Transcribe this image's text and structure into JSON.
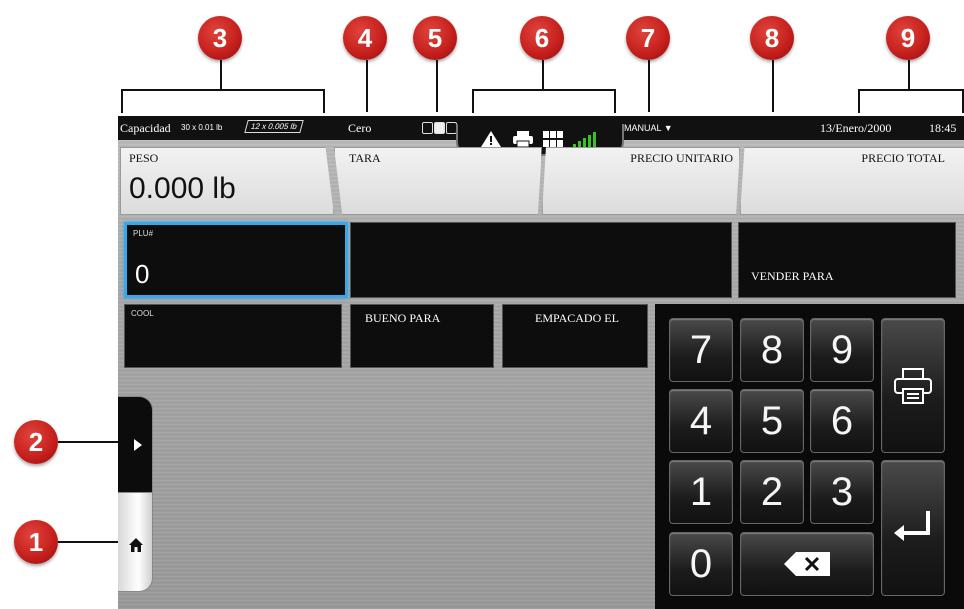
{
  "callouts": [
    "1",
    "2",
    "3",
    "4",
    "5",
    "6",
    "7",
    "8",
    "9"
  ],
  "statusbar": {
    "capacity_label": "Capacidad",
    "capacity_primary": "30 x 0.01 lb",
    "capacity_secondary": "12 x 0.005 lb",
    "zero_label": "Cero",
    "mode_label": "MANUAL",
    "date": "13/Enero/2000",
    "time": "18:45",
    "icons": [
      "warning-icon",
      "printer-icon",
      "grid-icon",
      "signal-icon"
    ]
  },
  "fields": {
    "peso_label": "PESO",
    "peso_value": "0.000 lb",
    "tara_label": "TARA",
    "unit_price_label": "PRECIO UNITARIO",
    "total_price_label": "PRECIO TOTAL"
  },
  "plu": {
    "label": "PLU#",
    "value": "0"
  },
  "sell_by_label": "VENDER PARA",
  "cool_label": "COOL",
  "good_for_label": "BUENO PARA",
  "packed_on_label": "EMPACADO EL",
  "keypad": {
    "keys": [
      "7",
      "8",
      "9",
      "4",
      "5",
      "6",
      "1",
      "2",
      "3",
      "0"
    ],
    "backspace_icon": "backspace-icon",
    "print_icon": "printer-icon",
    "enter_icon": "enter-icon"
  },
  "side": {
    "expand_icon": "chevron-right-icon",
    "home_icon": "home-icon"
  },
  "colors": {
    "callout": "#c41e1b",
    "plu_border": "#3aa7e6",
    "signal": "#39c12a"
  }
}
